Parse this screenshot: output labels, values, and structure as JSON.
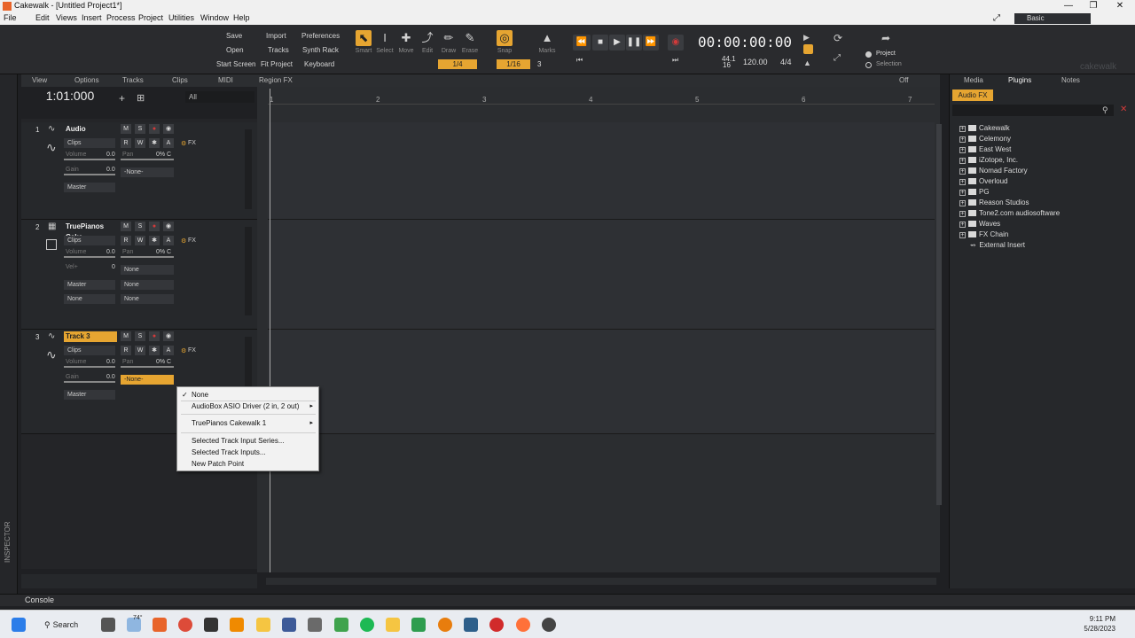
{
  "window": {
    "title": "Cakewalk - [Untitled Project1*]",
    "workspace": "Basic"
  },
  "menu": [
    "File",
    "Edit",
    "Views",
    "Insert",
    "Process",
    "Project",
    "Utilities",
    "Window",
    "Help"
  ],
  "control_bar": {
    "file_buttons": [
      "Save",
      "Open",
      "Start Screen"
    ],
    "import_buttons": [
      "Import",
      "Tracks",
      "Fit Project"
    ],
    "pref_buttons": [
      "Preferences",
      "Synth Rack",
      "Keyboard"
    ],
    "tools": [
      "Smart",
      "Select",
      "Move",
      "Edit",
      "Draw",
      "Erase"
    ],
    "tool_resolution": "1/4",
    "snap_label": "Snap",
    "snap_value": "1/16",
    "snap_count": "3",
    "marks_label": "Marks",
    "timecode": "00:00:00:00",
    "sample_rate": "44.1",
    "bit_depth": "16",
    "tempo": "120.00",
    "meter": "4/4",
    "project_label": "Project",
    "selection_label": "Selection"
  },
  "track_view": {
    "menus": [
      "View",
      "Options",
      "Tracks",
      "Clips",
      "MIDI",
      "Region FX"
    ],
    "now_time": "1:01:000",
    "filter": "All",
    "snap_off": "Off",
    "ruler_marks": [
      "1",
      "2",
      "3",
      "4",
      "5",
      "6",
      "7"
    ]
  },
  "tracks": [
    {
      "number": "1",
      "name": "Audio",
      "clips": "Clips",
      "volume_label": "Volume",
      "volume": "0.0",
      "pan_label": "Pan",
      "pan": "0% C",
      "gain_label": "Gain",
      "gain": "0.0",
      "input": "-None-",
      "output": "Master",
      "fx": "FX"
    },
    {
      "number": "2",
      "name": "TruePianos Cake",
      "clips": "Clips",
      "volume_label": "Volume",
      "volume": "0.0",
      "pan_label": "Pan",
      "pan": "0% C",
      "vel_label": "Vel+",
      "vel": "0",
      "input": "None",
      "output": "Master",
      "out2": "None",
      "ch": "None",
      "patch": "None",
      "fx": "FX"
    },
    {
      "number": "3",
      "name": "Track 3",
      "clips": "Clips",
      "volume_label": "Volume",
      "volume": "0.0",
      "pan_label": "Pan",
      "pan": "0% C",
      "gain_label": "Gain",
      "gain": "0.0",
      "input": "-None-",
      "output": "Master",
      "fx": "FX"
    }
  ],
  "context_menu": {
    "items": [
      "None",
      "AudioBox ASIO Driver (2 in, 2 out)",
      "TruePianos Cakewalk 1",
      "Selected Track Input Series...",
      "Selected Track Inputs...",
      "New Patch Point"
    ],
    "checked": "None"
  },
  "browser": {
    "tabs": [
      "Media",
      "Plugins",
      "Notes"
    ],
    "active_subtab": "Audio FX",
    "tree": [
      "Cakewalk",
      "Celemony",
      "East West",
      "iZotope, Inc.",
      "Nomad Factory",
      "Overloud",
      "PG",
      "Reason Studios",
      "Tone2.com audiosoftware",
      "Waves",
      "FX Chain",
      "External Insert"
    ],
    "watermark": "cakewalk"
  },
  "console_label": "Console",
  "inspector_label": "INSPECTOR",
  "taskbar": {
    "search": "Search",
    "weather": "74°",
    "time": "9:11 PM",
    "date": "5/28/2023"
  },
  "colors": {
    "accent": "#e6a531",
    "record": "#d23a3a",
    "background": "#1f2023"
  }
}
